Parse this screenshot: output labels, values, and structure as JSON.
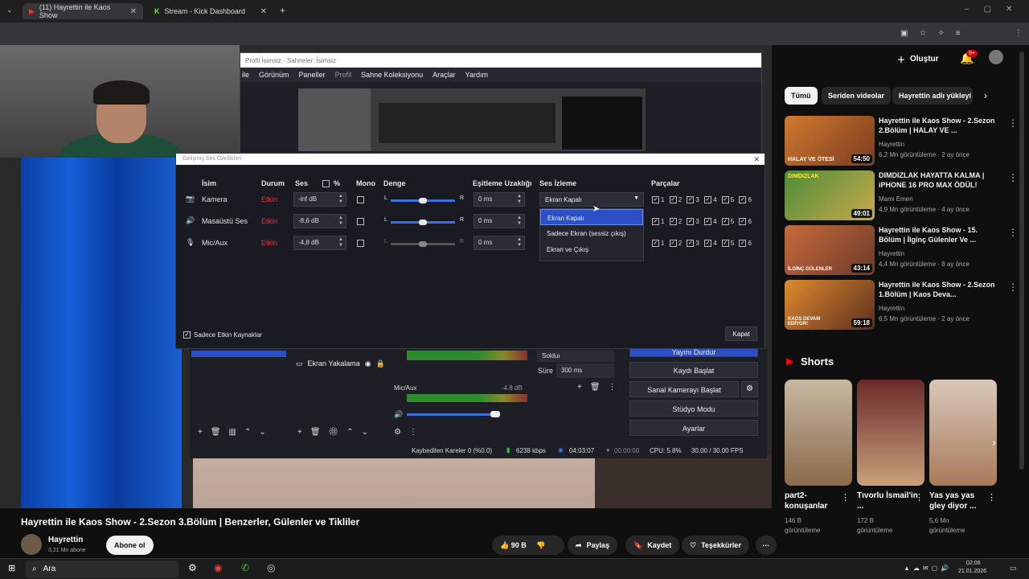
{
  "browser": {
    "tabs": [
      {
        "label": "(11) Hayrettin ile Kaos Show"
      },
      {
        "label": "Stream - Kick Dashboard"
      }
    ],
    "new_tab": "+"
  },
  "obs": {
    "window_title": "Profil İsimsiz - Sahneler: İsimsiz",
    "menu": [
      "ile",
      "Görünüm",
      "Paneller",
      "Profil",
      "Sahne Koleksiyonu",
      "Araçlar",
      "Yardım"
    ],
    "controls": [
      "Yayını Durdur",
      "Kaydı Başlat",
      "Sanal Kamerayı Başlat",
      "Stüdyo Modu",
      "Ayarlar"
    ],
    "sources": [
      "Kamera",
      "Ekran Yakalama"
    ],
    "mixer_label": "Mic/Aux",
    "mixer_db": "-4.8 dB",
    "transition_label": "Süre",
    "transition_value": "300 ms",
    "transition_type": "Solduı",
    "status": {
      "dropped": "Kaybedilen Kareler 0 (%0.0)",
      "bitrate": "6238 kbps",
      "live_time": "04:03:07",
      "rec_time": "00:00:00",
      "cpu": "CPU: 5.8%",
      "fps": "30.00 / 30.00 FPS"
    }
  },
  "dialog": {
    "title": "Gelişmiş Ses Özellikleri",
    "headers": {
      "name": "İsim",
      "status": "Durum",
      "volume": "Ses",
      "percent": "%",
      "mono": "Mono",
      "balance": "Denge",
      "sync": "Eşitleme Uzaklığı",
      "monitor": "Ses İzleme",
      "tracks": "Parçalar"
    },
    "rows": [
      {
        "name": "Kamera",
        "status": "Etkin",
        "volume": "-inf dB",
        "sync": "0 ms",
        "balance": 0.5
      },
      {
        "name": "Masaüstü Ses",
        "status": "Etkin",
        "volume": "-8,6 dB",
        "sync": "0 ms",
        "balance": 0.5
      },
      {
        "name": "Mic/Aux",
        "status": "Etkin",
        "volume": "-4,8 dB",
        "sync": "0 ms",
        "balance": 0.5
      }
    ],
    "balance_l": "L",
    "balance_r": "R",
    "monitor_selected": "Ekran Kapalı",
    "monitor_options": [
      "Ekran Kapalı",
      "Sadece Ekran (sessiz çıkış)",
      "Ekran ve Çıkış"
    ],
    "track_numbers": [
      "1",
      "2",
      "3",
      "4",
      "5",
      "6"
    ],
    "only_active_label": "Sadece Etkin Kaynaklar",
    "close_label": "Kapat"
  },
  "youtube": {
    "create_label": "Oluştur",
    "notif_count": "9+",
    "chips": [
      "Tümü",
      "Seriden videolar",
      "Hayrettin adlı yükleyi"
    ],
    "videos": [
      {
        "title": "Hayrettin ile Kaos Show - 2.Sezon 2.Bölüm | HALAY VE ...",
        "channel": "Hayrettin",
        "meta": "6,2 Mn görüntüleme · 2 ay önce",
        "duration": "54:50",
        "thumb_text": "HALAY VE ÖTESİ"
      },
      {
        "title": "DIMDIZLAK HAYATTA KALMA | iPHONE 16 PRO MAX ÖDÜL!",
        "channel": "Mami Emen",
        "meta": "4,9 Mn görüntüleme · 4 ay önce",
        "duration": "49:01",
        "thumb_text": "DIMDIZLAK"
      },
      {
        "title": "Hayrettin ile Kaos Show - 15. Bölüm | İlginç Gülenler Ve ...",
        "channel": "Hayrettin",
        "meta": "4,4 Mn görüntüleme · 8 ay önce",
        "duration": "43:14",
        "thumb_text": "İLGİNÇ GÜLENLER"
      },
      {
        "title": "Hayrettin ile Kaos Show - 2.Sezon 1.Bölüm | Kaos Deva...",
        "channel": "Hayrettin",
        "meta": "6,5 Mn görüntüleme · 2 ay önce",
        "duration": "59:18",
        "thumb_text": "KAOS DEVAM EDİYOR!"
      }
    ],
    "shorts_label": "Shorts",
    "shorts": [
      {
        "title": "part2-konuşanlar",
        "views": "146 B görüntüleme"
      },
      {
        "title": "Tıvorlu İsmail'in ...",
        "views": "172 B görüntüleme"
      },
      {
        "title": "Yas yas yas gley diyor ...",
        "views": "5,6 Mn görüntüleme"
      }
    ],
    "main_title": "Hayrettin ile Kaos Show - 2.Sezon 3.Bölüm | Benzerler, Gülenler ve Tikliler",
    "channel_name": "Hayrettin",
    "subs": "3,21 Mn abone",
    "subscribe": "Abone ol",
    "likes": "90 B",
    "share": "Paylaş",
    "save": "Kaydet",
    "thanks": "Teşekkürler"
  },
  "taskbar": {
    "search": "Ara",
    "time": "02:06",
    "date": "21.01.2026"
  }
}
